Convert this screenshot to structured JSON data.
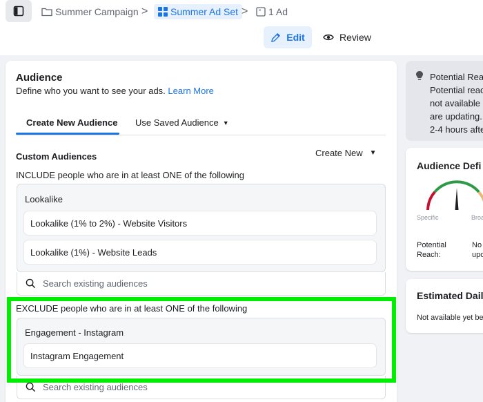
{
  "breadcrumb": {
    "campaign": "Summer Campaign",
    "adset": "Summer Ad Set",
    "ad": "1 Ad",
    "separator": ">"
  },
  "mode": {
    "edit_label": "Edit",
    "review_label": "Review"
  },
  "audience": {
    "title": "Audience",
    "subtitle": "Define who you want to see your ads.",
    "learn_more": "Learn More",
    "tabs": [
      {
        "label": "Create New Audience",
        "active": true
      },
      {
        "label": "Use Saved Audience",
        "active": false
      }
    ],
    "custom_label": "Custom Audiences",
    "create_new_label": "Create New",
    "include": {
      "label": "INCLUDE people who are in at least ONE of the following",
      "group_title": "Lookalike",
      "items": [
        "Lookalike (1% to 2%) - Website Visitors",
        "Lookalike (1%) - Website Leads"
      ],
      "search_placeholder": "Search existing audiences"
    },
    "exclude": {
      "label": "EXCLUDE people who are in at least ONE of the following",
      "group_title": "Engagement - Instagram",
      "items": [
        "Instagram Engagement"
      ],
      "search_placeholder": "Search existing audiences"
    }
  },
  "reach_notice": {
    "lines": [
      "Potential Rea",
      "Potential reac",
      "not available",
      "are updating.",
      "2-4 hours afte"
    ]
  },
  "definition": {
    "title": "Audience Defi",
    "specific_label": "Specific",
    "broad_label": "Broa",
    "potential_reach_label": "Potential Reach:",
    "potential_reach_value_1": "No",
    "potential_reach_value_2": "upo"
  },
  "estimated": {
    "title": "Estimated Dail",
    "text": "Not available yet be"
  },
  "colors": {
    "accent": "#1b74e4",
    "highlight": "#00ee00"
  }
}
